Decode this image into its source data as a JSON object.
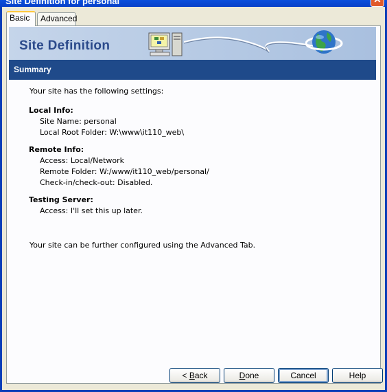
{
  "window": {
    "title": "Site Definition for personal",
    "close_glyph": "✕"
  },
  "tabs": [
    {
      "label": "Basic",
      "active": true
    },
    {
      "label": "Advanced",
      "active": false
    }
  ],
  "banner": {
    "title": "Site Definition",
    "computer_icon": "computer-icon",
    "globe_icon": "globe-icon"
  },
  "summary": {
    "header": "Summary",
    "intro": "Your site has the following settings:",
    "local_info": {
      "heading": "Local Info:",
      "site_name": "Site Name: personal",
      "root_folder": "Local Root Folder: W:\\www\\it110_web\\"
    },
    "remote_info": {
      "heading": "Remote Info:",
      "access": "Access: Local/Network",
      "remote_folder": "Remote Folder: W:/www/it110_web/personal/",
      "checkin": "Check-in/check-out: Disabled."
    },
    "testing_server": {
      "heading": "Testing Server:",
      "access": "Access: I'll set this up later."
    },
    "footer": "Your site can be further configured using the Advanced Tab."
  },
  "buttons": {
    "back_mnemonic": "B",
    "back_rest": "ack",
    "back_prefix": "< ",
    "done_mnemonic": "D",
    "done_rest": "one",
    "cancel": "Cancel",
    "help": "Help"
  },
  "colors": {
    "title_bar": "#0b4fdc",
    "summary_bar": "#1f4a8a",
    "banner_title": "#2b4a8b",
    "dialog_bg": "#ece9d8"
  }
}
